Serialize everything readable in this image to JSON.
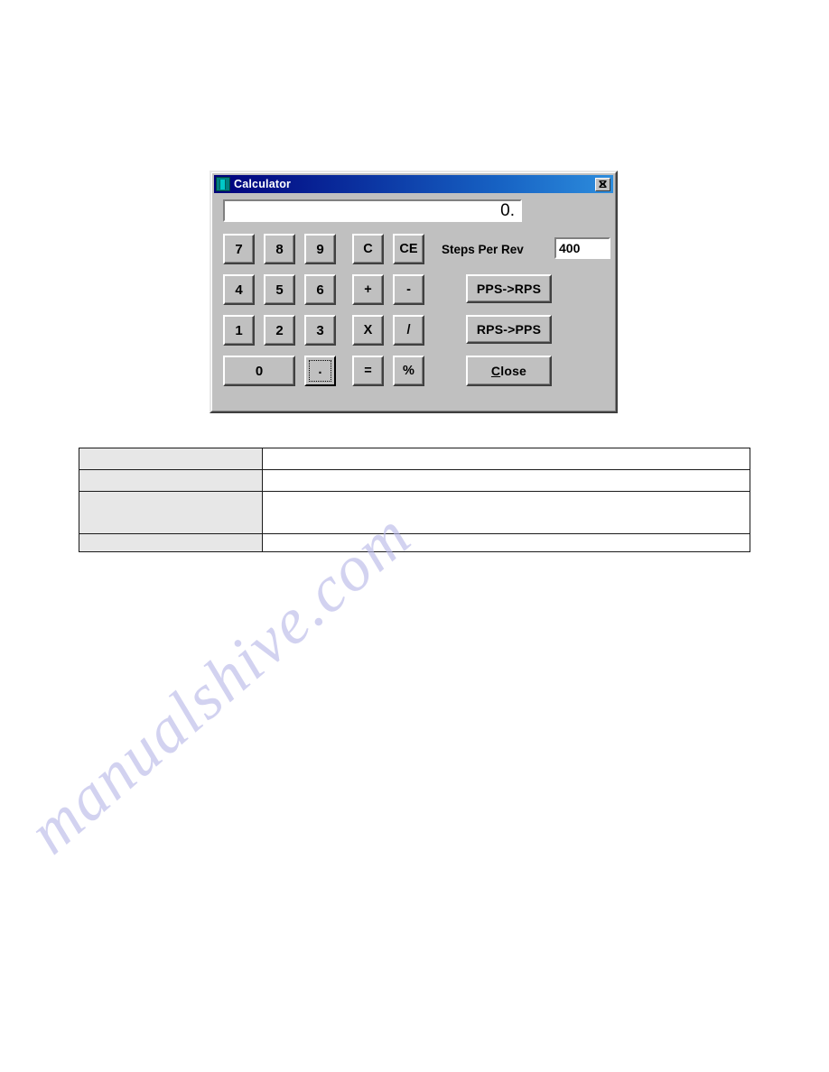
{
  "page": {
    "background_color": "#ffffff",
    "watermark": {
      "text": "manualshive.com",
      "color": "#b8b8e8"
    }
  },
  "dialog": {
    "title": "Calculator",
    "icon": "calculator-icon",
    "title_bar_color_start": "#00007b",
    "title_bar_color_end": "#2d8ddd",
    "face_color": "#c0c0c0",
    "close_button": {
      "icon": "close-x-icon",
      "label": "×"
    },
    "display": {
      "value": "0."
    },
    "keypad": [
      {
        "name": "seven",
        "label": "7"
      },
      {
        "name": "eight",
        "label": "8"
      },
      {
        "name": "nine",
        "label": "9"
      },
      {
        "name": "clear",
        "label": "C"
      },
      {
        "name": "clear-entry",
        "label": "CE"
      },
      {
        "name": "four",
        "label": "4"
      },
      {
        "name": "five",
        "label": "5"
      },
      {
        "name": "six",
        "label": "6"
      },
      {
        "name": "plus",
        "label": "+"
      },
      {
        "name": "minus",
        "label": "-"
      },
      {
        "name": "one",
        "label": "1"
      },
      {
        "name": "two",
        "label": "2"
      },
      {
        "name": "three",
        "label": "3"
      },
      {
        "name": "multiply",
        "label": "X"
      },
      {
        "name": "divide",
        "label": "/"
      },
      {
        "name": "zero",
        "label": "0"
      },
      {
        "name": "decimal-point",
        "label": "."
      },
      {
        "name": "equals",
        "label": "="
      },
      {
        "name": "percent",
        "label": "%"
      }
    ],
    "steps_per_rev": {
      "label": "Steps Per Rev",
      "value": "400"
    },
    "actions": {
      "pps_to_rps": "PPS->RPS",
      "rps_to_pps": "RPS->PPS",
      "close_accel": "C",
      "close_rest": "lose"
    }
  },
  "table": {
    "rows": [
      {
        "label": "",
        "value": ""
      },
      {
        "label": "",
        "value": ""
      },
      {
        "label": "",
        "value": ""
      },
      {
        "label": "",
        "value": ""
      }
    ]
  }
}
